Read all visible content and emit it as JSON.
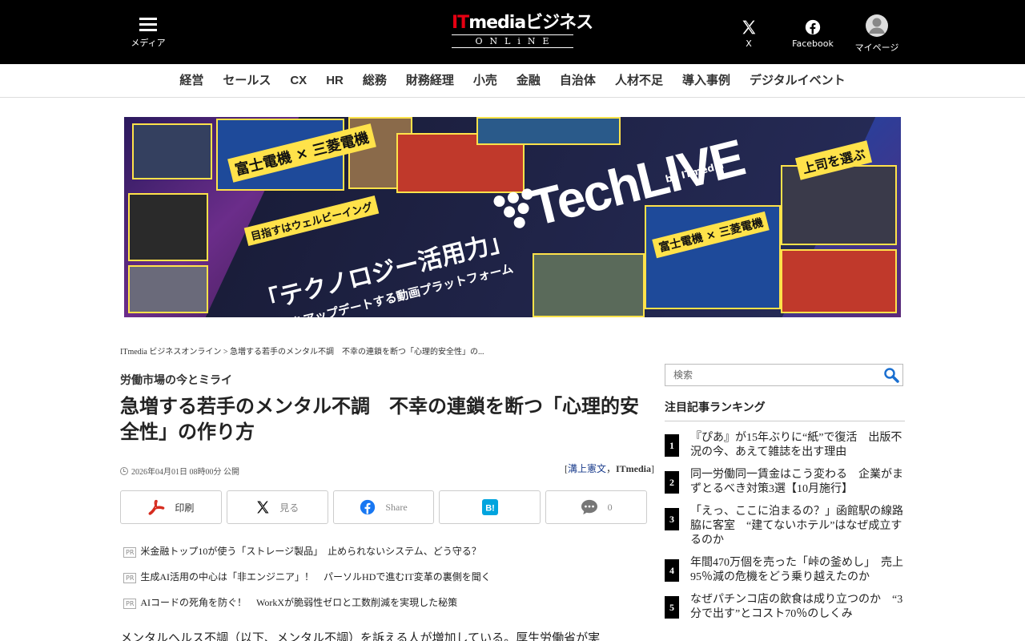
{
  "header": {
    "menu_label": "メディア",
    "logo_main_it": "IT",
    "logo_main_rest": "mediaビジネス",
    "logo_sub": "ONLiNE",
    "x_label": "X",
    "facebook_label": "Facebook",
    "mypage_label": "マイページ"
  },
  "categories": [
    "経営",
    "セールス",
    "CX",
    "HR",
    "総務",
    "財務経理",
    "小売",
    "金融",
    "自治体",
    "人材不足",
    "導入事例",
    "デジタルイベント"
  ],
  "banner": {
    "logo": "TechLIVE",
    "by": "by ITmedia",
    "tagline": "「テクノロジー活用力」",
    "tagline2": "をアップデートする動画プラットフォーム",
    "tag1": "富士電機 × 三菱電機",
    "tag2": "上司を選ぶ",
    "tag3": "目指すはウェルビーイング"
  },
  "breadcrumb": {
    "home": "ITmedia ビジネスオンライン",
    "sep": " > ",
    "current": "急増する若手のメンタル不調　不幸の連鎖を断つ「心理的安全性」の..."
  },
  "article": {
    "series": "労働市場の今とミライ",
    "title": "急増する若手のメンタル不調　不幸の連鎖を断つ「心理的安全性」の作り方",
    "date": "2026年04月01日 08時00分 公開",
    "author_open": "[",
    "author1": "溝上憲文",
    "author_sep": "，",
    "author2": "ITmedia",
    "author_close": "]",
    "body_first_line": "メンタルヘルス不調（以下、メンタル不調）を訴える人が増加している。厚生労働省が実"
  },
  "share": {
    "print": "印刷",
    "x": "見る",
    "facebook": "Share",
    "hatena": "",
    "comments": "0"
  },
  "pr_badge": "PR",
  "pr_items": [
    "米金融トップ10が使う「ストレージ製品」　止められないシステム、どう守る？",
    "生成AI活用の中心は「非エンジニア」！　パーソルHDで進むIT変革の裏側を聞く",
    "AIコードの死角を防ぐ！　WorkXが脆弱性ゼロと工数削減を実現した秘策"
  ],
  "sidebar": {
    "search_placeholder": "検索",
    "ranking_title": "注目記事ランキング",
    "ranking": [
      {
        "num": "1",
        "text": "『ぴあ』が15年ぶりに“紙”で復活　出版不況の今、あえて雑誌を出す理由"
      },
      {
        "num": "2",
        "text": "同一労働同一賃金はこう変わる　企業がまずとるべき対策3選【10月施行】"
      },
      {
        "num": "3",
        "text": "「えっ、ここに泊まるの？」函館駅の線路脇に客室　“建てないホテル”はなぜ成立するのか"
      },
      {
        "num": "4",
        "text": "年間470万個を売った「峠の釜めし」　売上95％減の危機をどう乗り越えたのか"
      },
      {
        "num": "5",
        "text": "なぜパチンコ店の飲食は成り立つのか　“3分で出す”とコスト70％のしくみ"
      }
    ]
  },
  "colors": {
    "header_bg": "#000000",
    "logo_accent": "#e60012",
    "link": "#1a3c8c",
    "search_icon": "#1a6fd0",
    "print_icon": "#d62c1f",
    "facebook": "#1877f2",
    "hatena": "#00a4de"
  }
}
